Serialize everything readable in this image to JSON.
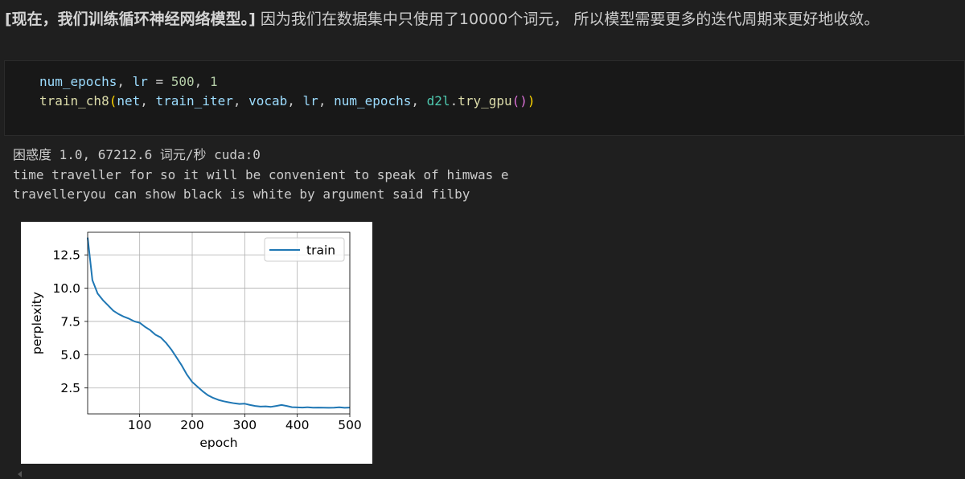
{
  "markdown": {
    "bold_text": "[现在，我们训练循环神经网络模型。]",
    "rest_text": " 因为我们在数据集中只使用了10000个词元， 所以模型需要更多的迭代周期来更好地收敛。"
  },
  "code": {
    "line1": {
      "var1": "num_epochs",
      "comma1": ", ",
      "var2": "lr",
      "op": " = ",
      "num1": "500",
      "comma2": ", ",
      "num2": "1"
    },
    "line2": {
      "fn": "train_ch8",
      "paren_open": "(",
      "arg1": "net",
      "sep1": ", ",
      "arg2": "train_iter",
      "sep2": ", ",
      "arg3": "vocab",
      "sep3": ", ",
      "arg4": "lr",
      "sep4": ", ",
      "arg5": "num_epochs",
      "sep5": ", ",
      "module": "d2l",
      "dot": ".",
      "method": "try_gpu",
      "inner_parens": "()",
      "paren_close": ")"
    }
  },
  "output": {
    "lines": [
      "困惑度 1.0, 67212.6 词元/秒 cuda:0",
      "time traveller for so it will be convenient to speak of himwas e",
      "travelleryou can show black is white by argument said filby"
    ]
  },
  "colors": {
    "series_line": "#1f77b4",
    "background": "#1f1f1f",
    "code_background": "#181818"
  },
  "chart_data": {
    "type": "line",
    "title": "",
    "xlabel": "epoch",
    "ylabel": "perplexity",
    "xlim": [
      1,
      500
    ],
    "ylim": [
      0.55,
      14.2
    ],
    "xticks": [
      100,
      200,
      300,
      400,
      500
    ],
    "yticks": [
      2.5,
      5.0,
      7.5,
      10.0,
      12.5
    ],
    "xtick_labels": [
      "100",
      "200",
      "300",
      "400",
      "500"
    ],
    "ytick_labels": [
      "2.5",
      "5.0",
      "7.5",
      "10.0",
      "12.5"
    ],
    "grid": true,
    "legend_position": "top-right",
    "series": [
      {
        "name": "train",
        "x": [
          1,
          10,
          20,
          30,
          40,
          50,
          60,
          70,
          80,
          90,
          100,
          110,
          120,
          130,
          140,
          150,
          160,
          170,
          180,
          190,
          200,
          210,
          220,
          230,
          240,
          250,
          260,
          270,
          280,
          290,
          300,
          310,
          320,
          330,
          340,
          350,
          360,
          370,
          380,
          390,
          400,
          410,
          420,
          430,
          440,
          450,
          460,
          470,
          480,
          490,
          500
        ],
        "values": [
          13.8,
          10.6,
          9.6,
          9.1,
          8.7,
          8.3,
          8.05,
          7.85,
          7.7,
          7.5,
          7.4,
          7.1,
          6.85,
          6.5,
          6.3,
          5.9,
          5.4,
          4.8,
          4.2,
          3.5,
          2.95,
          2.6,
          2.25,
          1.95,
          1.75,
          1.6,
          1.5,
          1.42,
          1.35,
          1.3,
          1.32,
          1.22,
          1.15,
          1.1,
          1.12,
          1.08,
          1.15,
          1.22,
          1.15,
          1.06,
          1.04,
          1.03,
          1.05,
          1.02,
          1.03,
          1.02,
          1.01,
          1.02,
          1.05,
          1.01,
          1.03
        ]
      }
    ]
  }
}
